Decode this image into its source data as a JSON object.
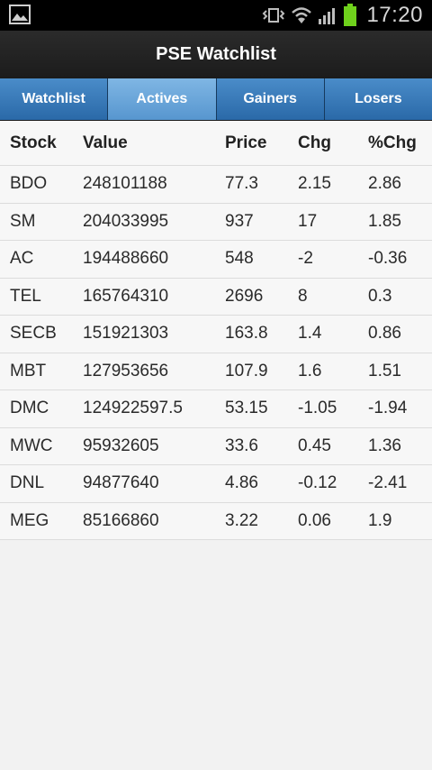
{
  "status_bar": {
    "time": "17:20",
    "icons": [
      "gallery-icon",
      "vibrate-icon",
      "wifi-icon",
      "signal-icon",
      "battery-icon"
    ]
  },
  "app": {
    "title": "PSE Watchlist"
  },
  "tabs": [
    {
      "label": "Watchlist",
      "active": false
    },
    {
      "label": "Actives",
      "active": true
    },
    {
      "label": "Gainers",
      "active": false
    },
    {
      "label": "Losers",
      "active": false
    }
  ],
  "table": {
    "headers": [
      "Stock",
      "Value",
      "Price",
      "Chg",
      "%Chg"
    ],
    "rows": [
      [
        "BDO",
        "248101188",
        "77.3",
        "2.15",
        "2.86"
      ],
      [
        "SM",
        "204033995",
        "937",
        "17",
        "1.85"
      ],
      [
        "AC",
        "194488660",
        "548",
        "-2",
        "-0.36"
      ],
      [
        "TEL",
        "165764310",
        "2696",
        "8",
        "0.3"
      ],
      [
        "SECB",
        "151921303",
        "163.8",
        "1.4",
        "0.86"
      ],
      [
        "MBT",
        "127953656",
        "107.9",
        "1.6",
        "1.51"
      ],
      [
        "DMC",
        "124922597.5",
        "53.15",
        "-1.05",
        "-1.94"
      ],
      [
        "MWC",
        "95932605",
        "33.6",
        "0.45",
        "1.36"
      ],
      [
        "DNL",
        "94877640",
        "4.86",
        "-0.12",
        "-2.41"
      ],
      [
        "MEG",
        "85166860",
        "3.22",
        "0.06",
        "1.9"
      ]
    ]
  },
  "colors": {
    "tab": "#2a69a8",
    "tab_active": "#5796cf",
    "battery": "#6fd11c"
  }
}
